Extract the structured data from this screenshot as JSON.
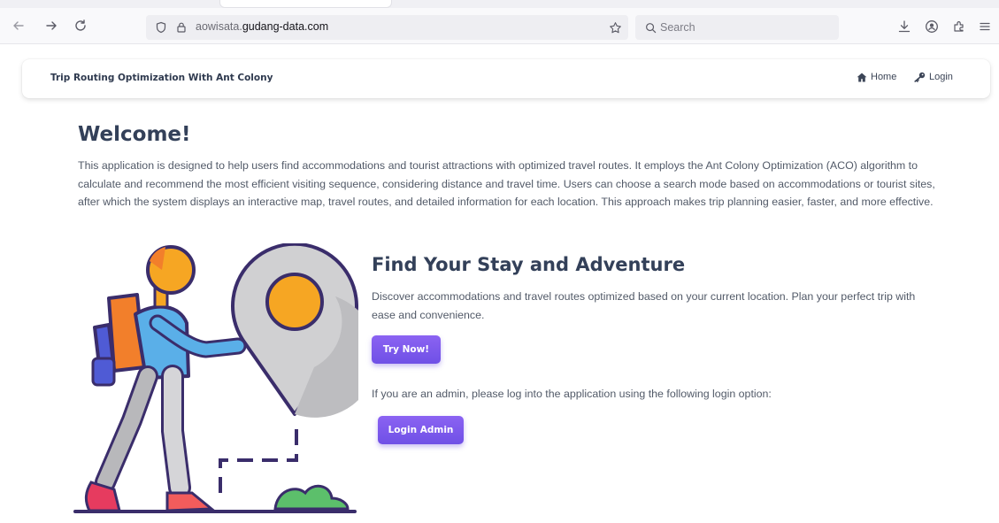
{
  "browser": {
    "url_subdomain": "aowisata.",
    "url_domain": "gudang-data.com",
    "search_placeholder": "Search"
  },
  "navbar": {
    "brand": "Trip Routing Optimization With Ant Colony",
    "home_label": "Home",
    "login_label": "Login"
  },
  "main": {
    "welcome_title": "Welcome!",
    "intro": "This application is designed to help users find accommodations and tourist attractions with optimized travel routes. It employs the Ant Colony Optimization (ACO) algorithm to calculate and recommend the most efficient visiting sequence, considering distance and travel time. Users can choose a search mode based on accommodations or tourist sites, after which the system displays an interactive map, travel routes, and detailed information for each location. This approach makes trip planning easier, faster, and more effective.",
    "find_title": "Find Your Stay and Adventure",
    "find_desc": "Discover accommodations and travel routes optimized based on your current location. Plan your perfect trip with ease and convenience.",
    "try_button": "Try Now!",
    "admin_text": "If you are an admin, please log into the application using the following login option:",
    "admin_button": "Login Admin"
  },
  "colors": {
    "accent": "#7a59ec",
    "heading": "#334059",
    "body_text": "#525a68"
  }
}
